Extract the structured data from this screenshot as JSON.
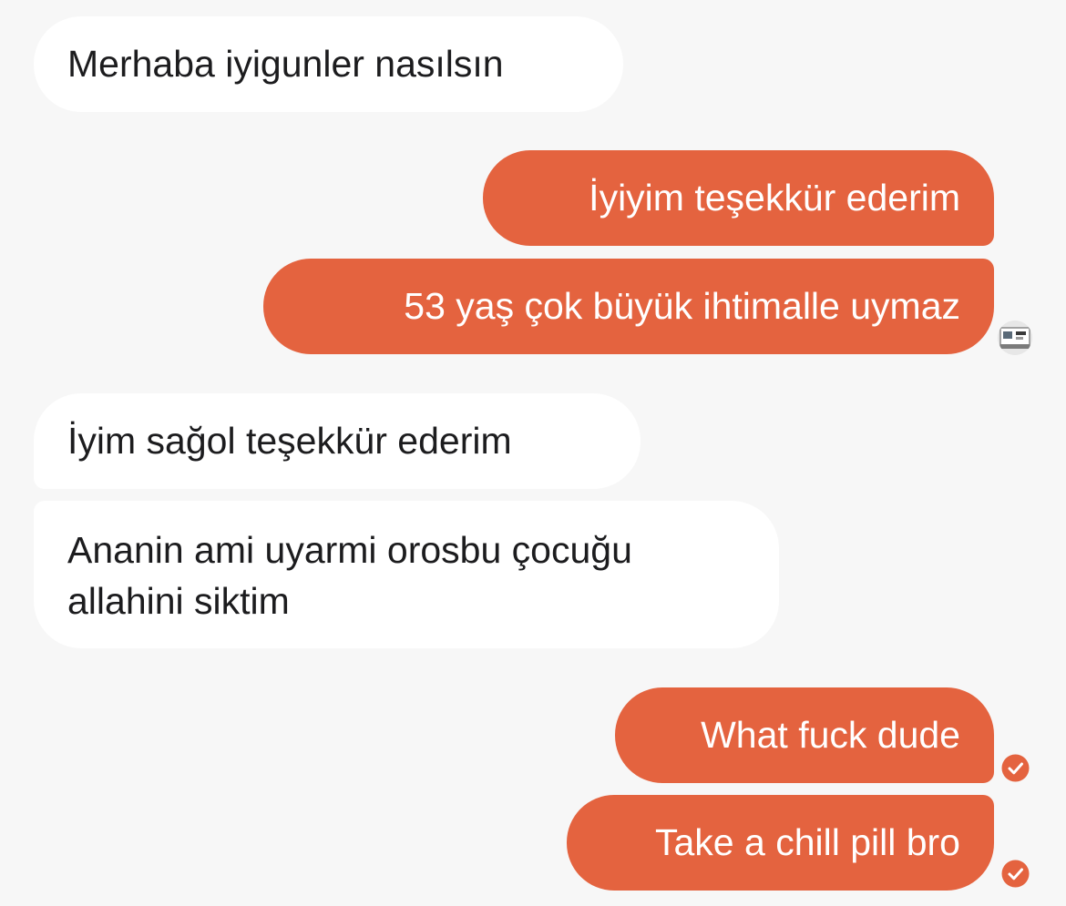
{
  "conversation": {
    "messages": [
      {
        "sender": "incoming",
        "text": "Merhaba iyigunler nasılsın"
      },
      {
        "sender": "outgoing",
        "text": "İyiyim teşekkür ederim"
      },
      {
        "sender": "outgoing",
        "text": "53 yaş çok büyük ihtimalle uymaz"
      },
      {
        "sender": "incoming",
        "text": "İyim sağol teşekkür ederim"
      },
      {
        "sender": "incoming",
        "text_line1": "Ananin ami uyarmi orosbu çocuğu",
        "text_line2": "allahini siktim"
      },
      {
        "sender": "outgoing",
        "text": "What fuck dude",
        "status": "read"
      },
      {
        "sender": "outgoing",
        "text": "Take a chill pill bro",
        "status": "read"
      }
    ]
  },
  "icons": {
    "read_receipt": "checkmark-circle-icon",
    "seen_avatar": "avatar-thumbnail"
  },
  "colors": {
    "background": "#f7f7f7",
    "incoming_bubble": "#ffffff",
    "incoming_text": "#1c1c1e",
    "outgoing_bubble": "#e4633f",
    "outgoing_text": "#ffffff"
  }
}
